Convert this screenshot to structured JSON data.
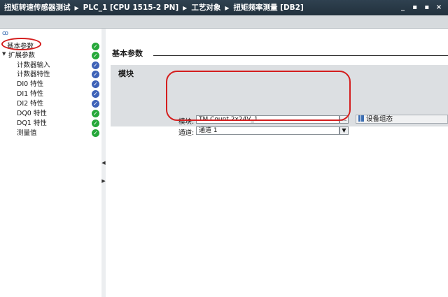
{
  "title_bar": {
    "breadcrumbs": [
      "扭矩转速传感器测试",
      "PLC_1 [CPU 1515-2 PN]",
      "工艺对象",
      "扭矩频率测量 [DB2]"
    ],
    "window_buttons": [
      "_",
      "▪",
      "▪",
      "×"
    ]
  },
  "nav": {
    "items": [
      {
        "label": "基本参数",
        "indent": 0,
        "caret": "",
        "status": "ok"
      },
      {
        "label": "扩展参数",
        "indent": 0,
        "caret": "▼",
        "status": "ok"
      },
      {
        "label": "计数器输入",
        "indent": 1,
        "caret": "",
        "status": "info"
      },
      {
        "label": "计数器特性",
        "indent": 1,
        "caret": "",
        "status": "info"
      },
      {
        "label": "DI0 特性",
        "indent": 1,
        "caret": "",
        "status": "info"
      },
      {
        "label": "DI1 特性",
        "indent": 1,
        "caret": "",
        "status": "info"
      },
      {
        "label": "DI2 特性",
        "indent": 1,
        "caret": "",
        "status": "info"
      },
      {
        "label": "DQ0 特性",
        "indent": 1,
        "caret": "",
        "status": "ok"
      },
      {
        "label": "DQ1 特性",
        "indent": 1,
        "caret": "",
        "status": "ok"
      },
      {
        "label": "测量值",
        "indent": 1,
        "caret": "",
        "status": "ok"
      }
    ]
  },
  "main": {
    "section_title": "基本参数",
    "panel_title": "模块",
    "module_label": "模块:",
    "module_value": "TM Count 2x24V_1",
    "browse_label": "...",
    "device_config_label": "设备组态",
    "channel_label": "通道:",
    "channel_value": "通道 1",
    "dropdown_glyph": "▼"
  },
  "colors": {
    "status_ok": "#26a83a",
    "status_info": "#3f63b8",
    "highlight": "#d41e1e",
    "title_bar": "#2a3a47"
  }
}
